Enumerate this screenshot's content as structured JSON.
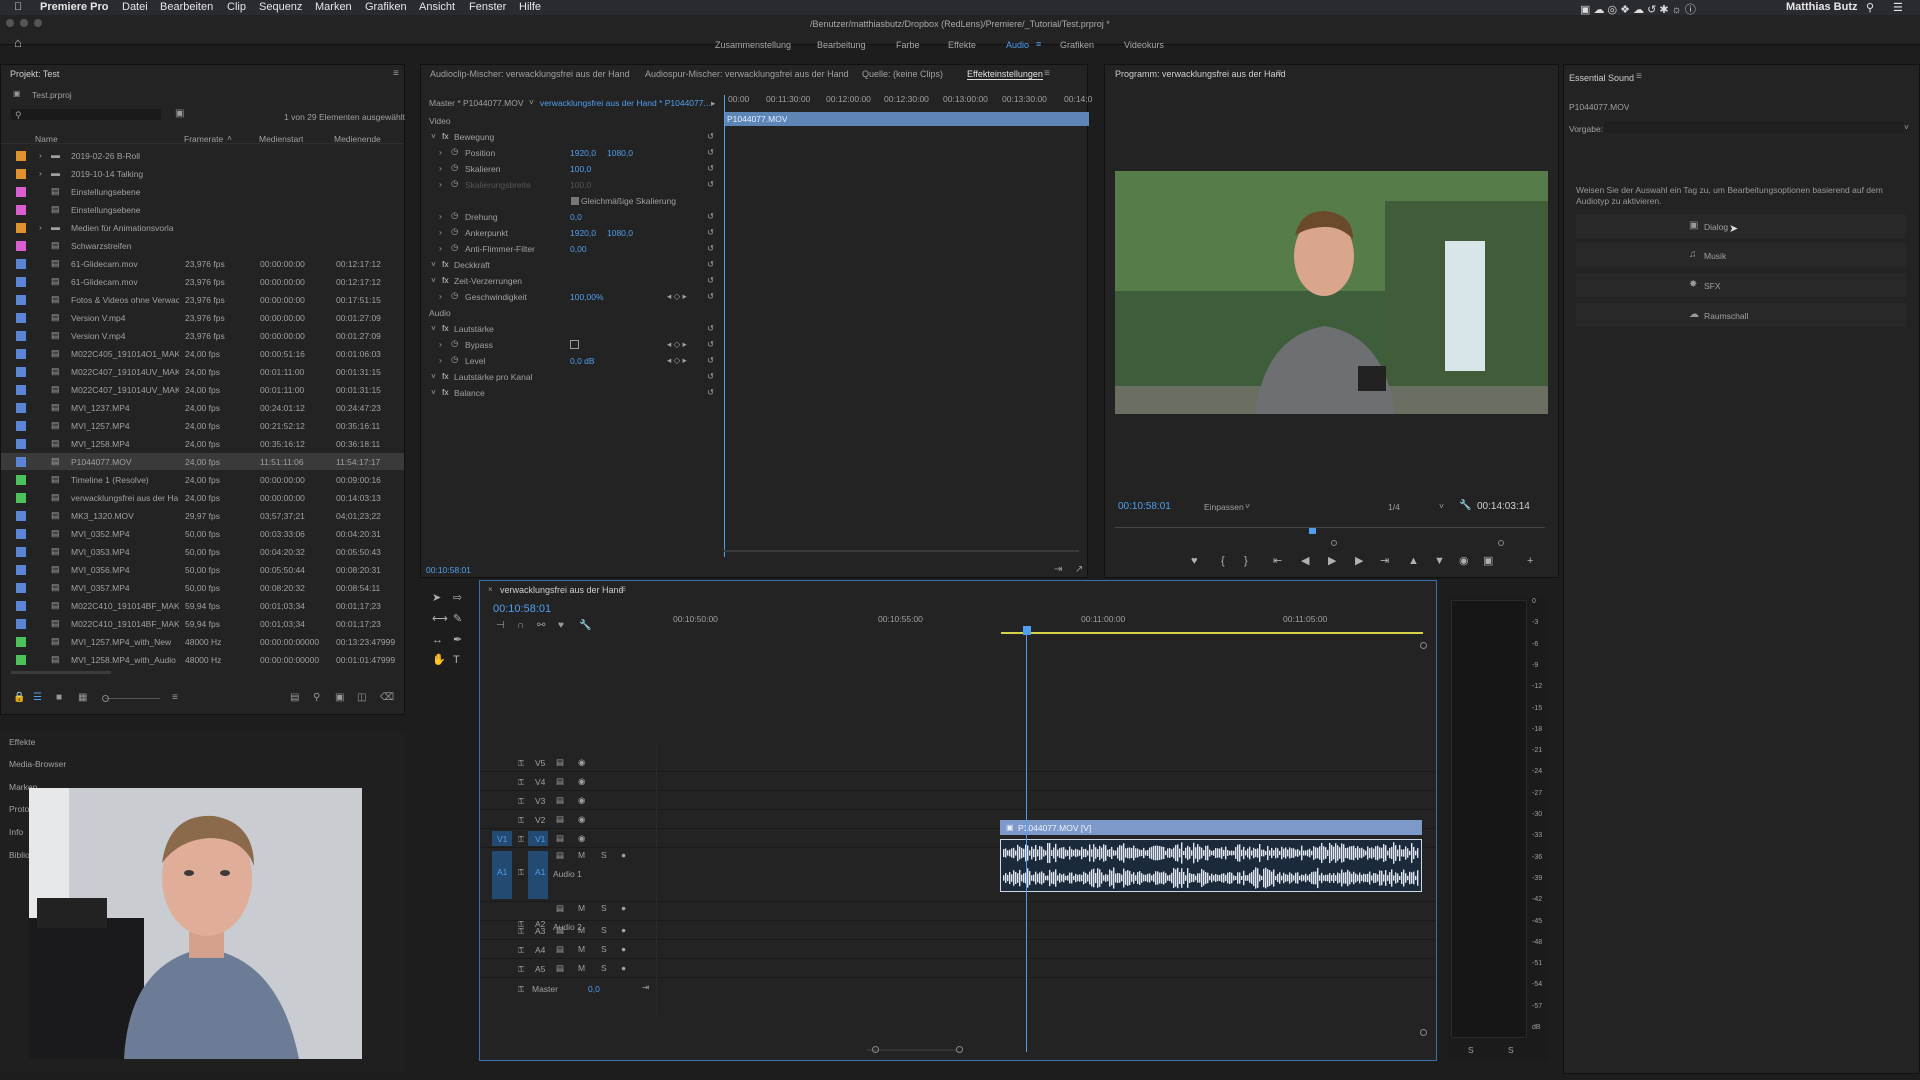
{
  "menubar": {
    "app": "Premiere Pro",
    "items": [
      "Datei",
      "Bearbeiten",
      "Clip",
      "Sequenz",
      "Marken",
      "Grafiken",
      "Ansicht",
      "Fenster",
      "Hilfe"
    ],
    "path": "/Benutzer/matthiasbutz/Dropbox (RedLens)/Premiere/_Tutorial/Test.prproj *",
    "user": "Matthias Butz"
  },
  "workspaces": [
    "Zusammenstellung",
    "Bearbeitung",
    "Farbe",
    "Effekte",
    "Audio",
    "Grafiken",
    "Videokurs"
  ],
  "active_workspace": "Audio",
  "project": {
    "title": "Projekt: Test",
    "file": "Test.prproj",
    "selection_info": "1 von 29 Elementen ausgewählt",
    "headers": {
      "name": "Name",
      "framerate": "Framerate",
      "start": "Medienstart",
      "end": "Medienende"
    },
    "rows": [
      {
        "color": "#e0922f",
        "name": "2019-02-26 B-Roll",
        "fps": "",
        "start": "",
        "end": ""
      },
      {
        "color": "#e0922f",
        "name": "2019-10-14 Talking",
        "fps": "",
        "start": "",
        "end": ""
      },
      {
        "color": "#d95fcf",
        "name": "Einstellungsebene",
        "fps": "",
        "start": "",
        "end": ""
      },
      {
        "color": "#d95fcf",
        "name": "Einstellungsebene",
        "fps": "",
        "start": "",
        "end": ""
      },
      {
        "color": "#e0922f",
        "name": "Medien für Animationsvorla",
        "fps": "",
        "start": "",
        "end": ""
      },
      {
        "color": "#d95fcf",
        "name": "Schwarzstreifen",
        "fps": "",
        "start": "",
        "end": ""
      },
      {
        "color": "#5b86d6",
        "name": "61-Glidecam.mov",
        "fps": "23,976 fps",
        "start": "00:00:00:00",
        "end": "00:12:17:12"
      },
      {
        "color": "#5b86d6",
        "name": "61-Glidecam.mov",
        "fps": "23,976 fps",
        "start": "00:00:00:00",
        "end": "00:12:17:12"
      },
      {
        "color": "#5b86d6",
        "name": "Fotos & Videos ohne Verwac",
        "fps": "23,976 fps",
        "start": "00:00:00:00",
        "end": "00:17:51:15"
      },
      {
        "color": "#5b86d6",
        "name": "Version V.mp4",
        "fps": "23,976 fps",
        "start": "00:00:00:00",
        "end": "00:01:27:09"
      },
      {
        "color": "#5b86d6",
        "name": "Version V.mp4",
        "fps": "23,976 fps",
        "start": "00:00:00:00",
        "end": "00:01:27:09"
      },
      {
        "color": "#5b86d6",
        "name": "M022C405_191014O1_MAK",
        "fps": "24,00 fps",
        "start": "00:00:51:16",
        "end": "00:01:06:03"
      },
      {
        "color": "#5b86d6",
        "name": "M022C407_191014UV_MAK",
        "fps": "24,00 fps",
        "start": "00:01:11:00",
        "end": "00:01:31:15"
      },
      {
        "color": "#5b86d6",
        "name": "M022C407_191014UV_MAK",
        "fps": "24,00 fps",
        "start": "00:01:11:00",
        "end": "00:01:31:15"
      },
      {
        "color": "#5b86d6",
        "name": "MVI_1237.MP4",
        "fps": "24,00 fps",
        "start": "00:24:01:12",
        "end": "00:24:47:23"
      },
      {
        "color": "#5b86d6",
        "name": "MVI_1257.MP4",
        "fps": "24,00 fps",
        "start": "00:21:52:12",
        "end": "00:35:16:11"
      },
      {
        "color": "#5b86d6",
        "name": "MVI_1258.MP4",
        "fps": "24,00 fps",
        "start": "00:35:16:12",
        "end": "00:36:18:11"
      },
      {
        "color": "#5b86d6",
        "name": "P1044077.MOV",
        "fps": "24,00 fps",
        "start": "11:51:11:06",
        "end": "11:54:17:17"
      },
      {
        "color": "#4ec25a",
        "name": "Timeline 1 (Resolve)",
        "fps": "24,00 fps",
        "start": "00:00:00:00",
        "end": "00:09:00:16"
      },
      {
        "color": "#4ec25a",
        "name": "verwacklungsfrei aus der Ha",
        "fps": "24,00 fps",
        "start": "00:00:00:00",
        "end": "00:14:03:13"
      },
      {
        "color": "#5b86d6",
        "name": "MK3_1320.MOV",
        "fps": "29,97 fps",
        "start": "03;57;37;21",
        "end": "04;01;23;22"
      },
      {
        "color": "#5b86d6",
        "name": "MVI_0352.MP4",
        "fps": "50,00 fps",
        "start": "00:03:33:06",
        "end": "00:04:20:31"
      },
      {
        "color": "#5b86d6",
        "name": "MVI_0353.MP4",
        "fps": "50,00 fps",
        "start": "00:04:20:32",
        "end": "00:05:50:43"
      },
      {
        "color": "#5b86d6",
        "name": "MVI_0356.MP4",
        "fps": "50,00 fps",
        "start": "00:05:50:44",
        "end": "00:08:20:31"
      },
      {
        "color": "#5b86d6",
        "name": "MVI_0357.MP4",
        "fps": "50,00 fps",
        "start": "00:08:20:32",
        "end": "00:08:54:11"
      },
      {
        "color": "#5b86d6",
        "name": "M022C410_191014BF_MAK",
        "fps": "59,94 fps",
        "start": "00:01;03;34",
        "end": "00:01;17;23"
      },
      {
        "color": "#5b86d6",
        "name": "M022C410_191014BF_MAK",
        "fps": "59,94 fps",
        "start": "00:01;03;34",
        "end": "00:01;17;23"
      },
      {
        "color": "#4ec25a",
        "name": "MVI_1257.MP4_with_New",
        "fps": "48000  Hz",
        "start": "00:00:00:00000",
        "end": "00:13:23:47999"
      },
      {
        "color": "#4ec25a",
        "name": "MVI_1258.MP4_with_Audio",
        "fps": "48000  Hz",
        "start": "00:00:00:00000",
        "end": "00:01:01:47999"
      }
    ]
  },
  "lower_left_panels": [
    "Effekte",
    "Media-Browser",
    "Marken",
    "Proto",
    "Info",
    "Biblio"
  ],
  "source_tabs": [
    "Audioclip-Mischer: verwacklungsfrei aus der Hand",
    "Audiospur-Mischer: verwacklungsfrei aus der Hand",
    "Quelle: (keine Clips)",
    "Effekteinstellungen"
  ],
  "effect_controls": {
    "master": "Master * P1044077.MOV",
    "sequence": "verwacklungsfrei aus der Hand * P1044077...",
    "ruler": [
      "00:00",
      "00:11:30:00",
      "00:12:00:00",
      "00:12:30:00",
      "00:13:00:00",
      "00:13:30:00",
      "00:14:0"
    ],
    "clip_label": "P1044077.MOV",
    "timecode": "00:10:58:01",
    "rows": [
      {
        "label": "Video",
        "indent": 0,
        "v1": "",
        "v2": ""
      },
      {
        "label": "Bewegung",
        "indent": 1,
        "v1": "",
        "v2": ""
      },
      {
        "label": "Position",
        "indent": 2,
        "v1": "1920,0",
        "v2": "1080,0"
      },
      {
        "label": "Skalieren",
        "indent": 2,
        "v1": "100,0",
        "v2": ""
      },
      {
        "label": "Skalierungsbreite",
        "indent": 2,
        "v1": "100,0",
        "v2": ""
      },
      {
        "label": "Gleichmäßige Skalierung",
        "indent": 3,
        "v1": "",
        "v2": ""
      },
      {
        "label": "Drehung",
        "indent": 2,
        "v1": "0,0",
        "v2": ""
      },
      {
        "label": "Ankerpunkt",
        "indent": 2,
        "v1": "1920,0",
        "v2": "1080,0"
      },
      {
        "label": "Anti-Flimmer-Filter",
        "indent": 2,
        "v1": "0,00",
        "v2": ""
      },
      {
        "label": "Deckkraft",
        "indent": 1,
        "v1": "",
        "v2": ""
      },
      {
        "label": "Zeit-Verzerrungen",
        "indent": 1,
        "v1": "",
        "v2": ""
      },
      {
        "label": "Geschwindigkeit",
        "indent": 2,
        "v1": "100,00%",
        "v2": ""
      },
      {
        "label": "Audio",
        "indent": 0,
        "v1": "",
        "v2": ""
      },
      {
        "label": "Lautstärke",
        "indent": 1,
        "v1": "",
        "v2": ""
      },
      {
        "label": "Bypass",
        "indent": 2,
        "v1": "",
        "v2": ""
      },
      {
        "label": "Level",
        "indent": 2,
        "v1": "0,0 dB",
        "v2": ""
      },
      {
        "label": "Lautstärke pro Kanal",
        "indent": 1,
        "v1": "",
        "v2": ""
      },
      {
        "label": "Balance",
        "indent": 1,
        "v1": "",
        "v2": ""
      }
    ]
  },
  "program": {
    "title": "Programm: verwacklungsfrei aus der Hand",
    "timecode": "00:10:58:01",
    "fit": "Einpassen",
    "resolution": "1/4",
    "duration": "00:14:03:14"
  },
  "essential_sound": {
    "title": "Essential Sound",
    "clip": "P1044077.MOV",
    "preset_label": "Vorgabe:",
    "hint": "Weisen Sie der Auswahl ein Tag zu, um Bearbeitungsoptionen basierend auf dem Audiotyp zu aktivieren.",
    "types": [
      "Dialog",
      "Musik",
      "SFX",
      "Raumschall"
    ]
  },
  "timeline": {
    "title": "verwacklungsfrei aus der Hand",
    "timecode": "00:10:58:01",
    "ruler": [
      "00:10:50:00",
      "00:10:55:00",
      "00:11:00:00",
      "00:11:05:00"
    ],
    "video_tracks": [
      "V5",
      "V4",
      "V3",
      "V2",
      "V1"
    ],
    "audio_tracks": [
      "A1",
      "A2",
      "A3",
      "A4",
      "A5"
    ],
    "audio_names": [
      "Audio 1",
      "Audio 2"
    ],
    "master_label": "Master",
    "master_value": "0,0",
    "clip_name": "P1044077.MOV [V]",
    "src_v": "V1",
    "src_a": "A1"
  },
  "meter_scale": [
    "0",
    "-3",
    "-6",
    "-9",
    "-12",
    "-15",
    "-18",
    "-21",
    "-24",
    "-27",
    "-30",
    "-33",
    "-36",
    "-39",
    "-42",
    "-45",
    "-48",
    "-51",
    "-54",
    "-57",
    "dB"
  ],
  "meter_solo": [
    "S",
    "S"
  ]
}
